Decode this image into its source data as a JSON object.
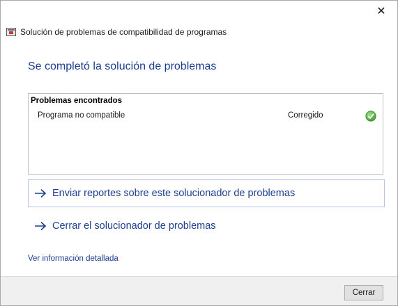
{
  "window": {
    "title": "Solución de problemas de compatibilidad de programas",
    "close_glyph": "✕"
  },
  "main": {
    "heading": "Se completó la solución de problemas",
    "problems": {
      "header": "Problemas encontrados",
      "rows": [
        {
          "name": "Programa no compatible",
          "status": "Corregido",
          "status_icon": "check-icon",
          "status_color": "#5cb85c"
        }
      ]
    },
    "links": [
      {
        "label": "Enviar reportes sobre este solucionador de problemas",
        "icon": "arrow-right-icon"
      },
      {
        "label": "Cerrar el solucionador de problemas",
        "icon": "arrow-right-icon"
      }
    ],
    "detail_link": "Ver información detallada"
  },
  "footer": {
    "close_label": "Cerrar"
  },
  "colors": {
    "link": "#1b3f8f",
    "footer_bg": "#f0f0f0"
  }
}
